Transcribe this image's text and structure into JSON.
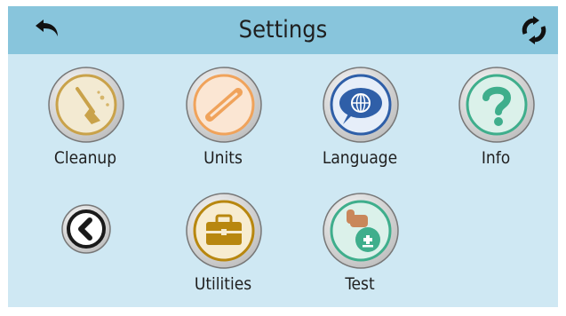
{
  "header": {
    "title": "Settings",
    "back_icon": "back-arrow-icon",
    "refresh_icon": "refresh-icon"
  },
  "tiles": [
    {
      "label": "Cleanup",
      "icon": "broom-icon",
      "accent": "#c9a24a"
    },
    {
      "label": "Units",
      "icon": "ruler-icon",
      "accent": "#f0a35b"
    },
    {
      "label": "Language",
      "icon": "globe-speech-icon",
      "accent": "#2f5fa8"
    },
    {
      "label": "Info",
      "icon": "question-icon",
      "accent": "#3fae8c"
    },
    {
      "label": "",
      "icon": "chevron-left-icon",
      "accent": "#1a1a1a"
    },
    {
      "label": "Utilities",
      "icon": "toolbox-icon",
      "accent": "#b8870f"
    },
    {
      "label": "Test",
      "icon": "hand-plus-icon",
      "accent": "#3fae8c"
    }
  ]
}
